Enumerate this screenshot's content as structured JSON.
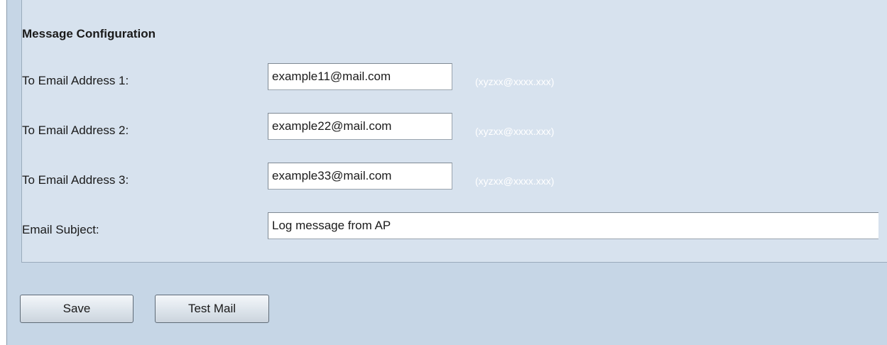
{
  "message_configuration": {
    "title": "Message Configuration",
    "fields": [
      {
        "label": "To Email Address 1:",
        "value": "example11@mail.com",
        "hint": "(xyzxx@xxxx.xxx)"
      },
      {
        "label": "To Email Address 2:",
        "value": "example22@mail.com",
        "hint": "(xyzxx@xxxx.xxx)"
      },
      {
        "label": "To Email Address 3:",
        "value": "example33@mail.com",
        "hint": "(xyzxx@xxxx.xxx)"
      }
    ],
    "subject": {
      "label": "Email Subject:",
      "value": "Log message from AP"
    }
  },
  "buttons": {
    "save_label": "Save",
    "test_mail_label": "Test Mail"
  },
  "colors": {
    "page_background": "#c6d6e6",
    "panel_background": "#d7e2ee",
    "hint_text": "#ffffff"
  }
}
